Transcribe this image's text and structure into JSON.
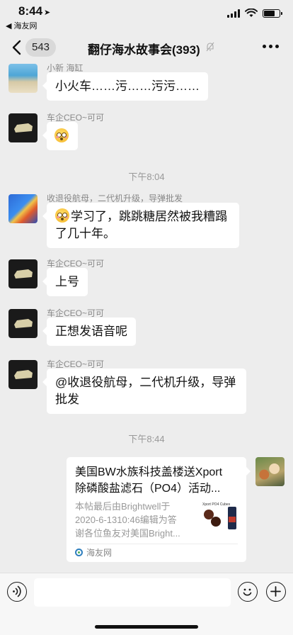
{
  "status_bar": {
    "time": "8:44",
    "location_arrow": "➤",
    "back_to_app": "◀ 海友网",
    "battery_level": 0.7
  },
  "nav": {
    "unread_count": "543",
    "title": "翻仔海水故事会(393)"
  },
  "messages": [
    {
      "sender": "小新 海缸",
      "text": "小火车……污……污污……"
    },
    {
      "sender": "车企CEO~可可",
      "emoji": "flushed-face"
    },
    {
      "time": "下午8:04"
    },
    {
      "sender": "收退役航母，二代机升级，导弹批发",
      "text_line1": "学习了，跳跳糖居然被我糟蹋",
      "text_line2": "了几十年。"
    },
    {
      "sender": "车企CEO~可可",
      "text": "上号"
    },
    {
      "sender": "车企CEO~可可",
      "text": "正想发语音呢"
    },
    {
      "sender": "车企CEO~可可",
      "text_line1": "@收退役航母，二代机升级，导弹",
      "text_line2": "批发"
    },
    {
      "time": "下午8:44"
    }
  ],
  "link_card": {
    "title_line1": "美国BW水族科技盖楼送Xport",
    "title_line2": "除磷酸盐滤石（PO4）活动...",
    "desc_line1": "本帖最后由Brightwell于",
    "desc_line2": "2020-6-1310:46编辑为答",
    "desc_line3": "谢各位鱼友对美国Bright...",
    "thumb_label": "Xport PO4 Cubes",
    "source": "海友网"
  },
  "icons": {
    "back": "chevron-left-icon",
    "mute": "bell-off-icon",
    "more": "ellipsis-icon",
    "voice": "voice-icon",
    "emoji": "smiley-icon",
    "plus": "plus-icon"
  },
  "colors": {
    "background": "#ededed",
    "bubble": "#ffffff",
    "time_text": "#999999"
  }
}
